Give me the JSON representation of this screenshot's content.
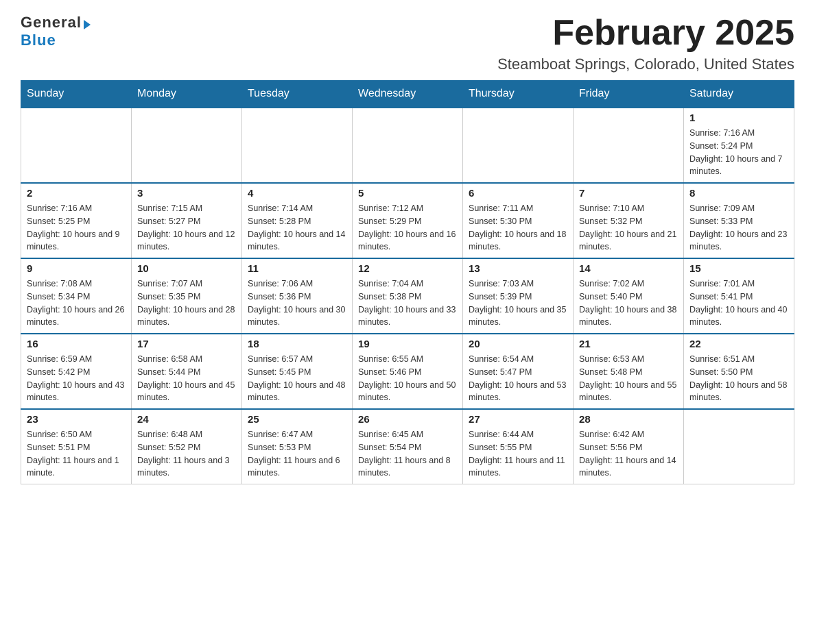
{
  "logo": {
    "general": "General",
    "blue": "Blue"
  },
  "title": "February 2025",
  "location": "Steamboat Springs, Colorado, United States",
  "days_of_week": [
    "Sunday",
    "Monday",
    "Tuesday",
    "Wednesday",
    "Thursday",
    "Friday",
    "Saturday"
  ],
  "weeks": [
    [
      {
        "day": "",
        "info": ""
      },
      {
        "day": "",
        "info": ""
      },
      {
        "day": "",
        "info": ""
      },
      {
        "day": "",
        "info": ""
      },
      {
        "day": "",
        "info": ""
      },
      {
        "day": "",
        "info": ""
      },
      {
        "day": "1",
        "info": "Sunrise: 7:16 AM\nSunset: 5:24 PM\nDaylight: 10 hours and 7 minutes."
      }
    ],
    [
      {
        "day": "2",
        "info": "Sunrise: 7:16 AM\nSunset: 5:25 PM\nDaylight: 10 hours and 9 minutes."
      },
      {
        "day": "3",
        "info": "Sunrise: 7:15 AM\nSunset: 5:27 PM\nDaylight: 10 hours and 12 minutes."
      },
      {
        "day": "4",
        "info": "Sunrise: 7:14 AM\nSunset: 5:28 PM\nDaylight: 10 hours and 14 minutes."
      },
      {
        "day": "5",
        "info": "Sunrise: 7:12 AM\nSunset: 5:29 PM\nDaylight: 10 hours and 16 minutes."
      },
      {
        "day": "6",
        "info": "Sunrise: 7:11 AM\nSunset: 5:30 PM\nDaylight: 10 hours and 18 minutes."
      },
      {
        "day": "7",
        "info": "Sunrise: 7:10 AM\nSunset: 5:32 PM\nDaylight: 10 hours and 21 minutes."
      },
      {
        "day": "8",
        "info": "Sunrise: 7:09 AM\nSunset: 5:33 PM\nDaylight: 10 hours and 23 minutes."
      }
    ],
    [
      {
        "day": "9",
        "info": "Sunrise: 7:08 AM\nSunset: 5:34 PM\nDaylight: 10 hours and 26 minutes."
      },
      {
        "day": "10",
        "info": "Sunrise: 7:07 AM\nSunset: 5:35 PM\nDaylight: 10 hours and 28 minutes."
      },
      {
        "day": "11",
        "info": "Sunrise: 7:06 AM\nSunset: 5:36 PM\nDaylight: 10 hours and 30 minutes."
      },
      {
        "day": "12",
        "info": "Sunrise: 7:04 AM\nSunset: 5:38 PM\nDaylight: 10 hours and 33 minutes."
      },
      {
        "day": "13",
        "info": "Sunrise: 7:03 AM\nSunset: 5:39 PM\nDaylight: 10 hours and 35 minutes."
      },
      {
        "day": "14",
        "info": "Sunrise: 7:02 AM\nSunset: 5:40 PM\nDaylight: 10 hours and 38 minutes."
      },
      {
        "day": "15",
        "info": "Sunrise: 7:01 AM\nSunset: 5:41 PM\nDaylight: 10 hours and 40 minutes."
      }
    ],
    [
      {
        "day": "16",
        "info": "Sunrise: 6:59 AM\nSunset: 5:42 PM\nDaylight: 10 hours and 43 minutes."
      },
      {
        "day": "17",
        "info": "Sunrise: 6:58 AM\nSunset: 5:44 PM\nDaylight: 10 hours and 45 minutes."
      },
      {
        "day": "18",
        "info": "Sunrise: 6:57 AM\nSunset: 5:45 PM\nDaylight: 10 hours and 48 minutes."
      },
      {
        "day": "19",
        "info": "Sunrise: 6:55 AM\nSunset: 5:46 PM\nDaylight: 10 hours and 50 minutes."
      },
      {
        "day": "20",
        "info": "Sunrise: 6:54 AM\nSunset: 5:47 PM\nDaylight: 10 hours and 53 minutes."
      },
      {
        "day": "21",
        "info": "Sunrise: 6:53 AM\nSunset: 5:48 PM\nDaylight: 10 hours and 55 minutes."
      },
      {
        "day": "22",
        "info": "Sunrise: 6:51 AM\nSunset: 5:50 PM\nDaylight: 10 hours and 58 minutes."
      }
    ],
    [
      {
        "day": "23",
        "info": "Sunrise: 6:50 AM\nSunset: 5:51 PM\nDaylight: 11 hours and 1 minute."
      },
      {
        "day": "24",
        "info": "Sunrise: 6:48 AM\nSunset: 5:52 PM\nDaylight: 11 hours and 3 minutes."
      },
      {
        "day": "25",
        "info": "Sunrise: 6:47 AM\nSunset: 5:53 PM\nDaylight: 11 hours and 6 minutes."
      },
      {
        "day": "26",
        "info": "Sunrise: 6:45 AM\nSunset: 5:54 PM\nDaylight: 11 hours and 8 minutes."
      },
      {
        "day": "27",
        "info": "Sunrise: 6:44 AM\nSunset: 5:55 PM\nDaylight: 11 hours and 11 minutes."
      },
      {
        "day": "28",
        "info": "Sunrise: 6:42 AM\nSunset: 5:56 PM\nDaylight: 11 hours and 14 minutes."
      },
      {
        "day": "",
        "info": ""
      }
    ]
  ]
}
